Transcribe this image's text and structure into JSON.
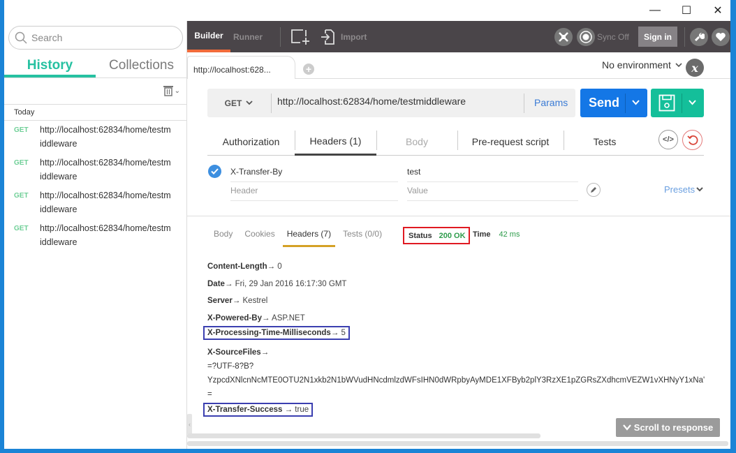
{
  "window": {
    "controls": {
      "minimize": "—",
      "maximize": "☐",
      "close": "✕"
    }
  },
  "sidebar": {
    "search_placeholder": "Search",
    "tabs": [
      {
        "label": "History",
        "active": true
      },
      {
        "label": "Collections",
        "active": false
      }
    ],
    "group_label": "Today",
    "history": [
      {
        "method": "GET",
        "url": "http://localhost:62834/home/testmiddleware"
      },
      {
        "method": "GET",
        "url": "http://localhost:62834/home/testmiddleware"
      },
      {
        "method": "GET",
        "url": "http://localhost:62834/home/testmiddleware"
      },
      {
        "method": "GET",
        "url": "http://localhost:62834/home/testmiddleware"
      }
    ]
  },
  "topbar": {
    "builder": "Builder",
    "runner": "Runner",
    "import": "Import",
    "sync": "Sync Off",
    "signin": "Sign in"
  },
  "tabs": {
    "request_tab": "http://localhost:628...",
    "environment": "No environment"
  },
  "request": {
    "method": "GET",
    "url": "http://localhost:62834/home/testmiddleware",
    "params_label": "Params",
    "send_label": "Send",
    "tabs": [
      {
        "label": "Authorization",
        "state": "normal"
      },
      {
        "label": "Headers (1)",
        "state": "active"
      },
      {
        "label": "Body",
        "state": "disabled"
      },
      {
        "label": "Pre-request script",
        "state": "normal"
      },
      {
        "label": "Tests",
        "state": "normal"
      }
    ],
    "headers": [
      {
        "key": "X-Transfer-By",
        "value": "test",
        "enabled": true
      }
    ],
    "header_placeholder": "Header",
    "value_placeholder": "Value",
    "presets_label": "Presets"
  },
  "response": {
    "tabs": [
      {
        "label": "Body",
        "active": false
      },
      {
        "label": "Cookies",
        "active": false
      },
      {
        "label": "Headers (7)",
        "active": true
      },
      {
        "label": "Tests (0/0)",
        "active": false
      }
    ],
    "status_label": "Status",
    "status_value": "200 OK",
    "time_label": "Time",
    "time_value": "42 ms",
    "headers": [
      {
        "key": "Content-Length",
        "value": "0",
        "highlight": false
      },
      {
        "key": "Date",
        "value": "Fri, 29 Jan 2016 16:17:30 GMT",
        "highlight": false
      },
      {
        "key": "Server",
        "value": "Kestrel",
        "highlight": false
      },
      {
        "key": "X-Powered-By",
        "value": "ASP.NET",
        "highlight": false
      },
      {
        "key": "X-Processing-Time-Milliseconds",
        "value": "5",
        "highlight": true
      },
      {
        "key": "X-SourceFiles",
        "value": "",
        "highlight": false
      },
      {
        "key": "X-Transfer-Success",
        "value": "true",
        "highlight": true
      }
    ],
    "sourcefiles_lines": [
      "=?UTF-8?B?",
      "YzpcdXNlcnNcMTE0OTU2N1xkb2N1bWVudHNcdmlzdWFsIHN0dWRpbyAyMDE1XFByb2plY3RzXE1pZGRsZXdhcmVEZW1vXHNyY1xNa'",
      "="
    ],
    "arrow": "→",
    "scroll_to_response": "Scroll to response"
  }
}
